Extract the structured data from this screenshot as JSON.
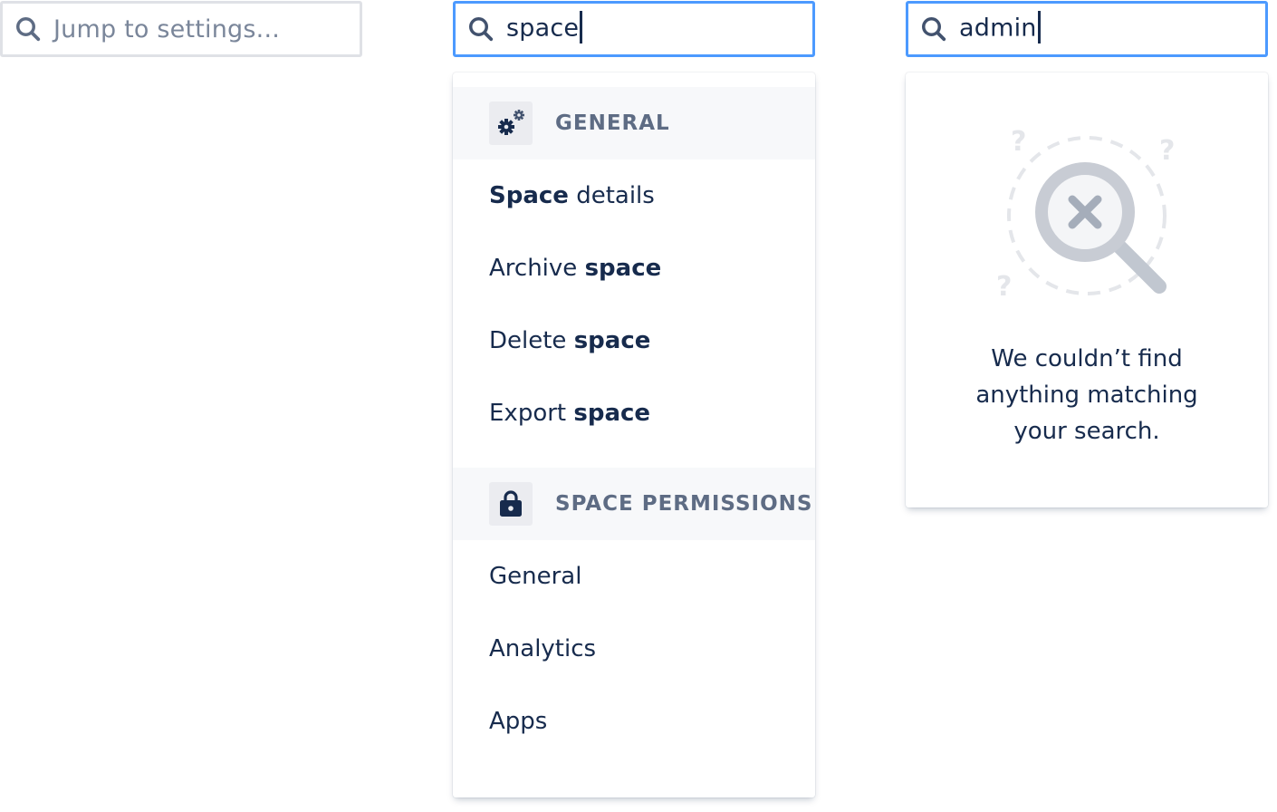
{
  "searches": [
    {
      "placeholder": "Jump to settings...",
      "value": ""
    },
    {
      "placeholder": "",
      "value": "space"
    },
    {
      "placeholder": "",
      "value": "admin"
    }
  ],
  "results": {
    "groups": [
      {
        "title": "GENERAL",
        "icon": "gears-icon",
        "items": [
          {
            "pre": "",
            "bold": "Space",
            "post": " details"
          },
          {
            "pre": "Archive ",
            "bold": "space",
            "post": ""
          },
          {
            "pre": "Delete ",
            "bold": "space",
            "post": ""
          },
          {
            "pre": "Export ",
            "bold": "space",
            "post": ""
          }
        ]
      },
      {
        "title": "SPACE PERMISSIONS",
        "icon": "lock-icon",
        "items": [
          {
            "pre": "General",
            "bold": "",
            "post": ""
          },
          {
            "pre": "Analytics",
            "bold": "",
            "post": ""
          },
          {
            "pre": "Apps",
            "bold": "",
            "post": ""
          }
        ]
      }
    ]
  },
  "empty_state": {
    "illustration": "no-results-magnifier-icon",
    "line1": "We couldn’t find",
    "line2": "anything matching",
    "line3": "your search."
  },
  "colors": {
    "text": "#172B4D",
    "subtle": "#5E6C84",
    "placeholder": "#7A869A",
    "focus_border": "#4C9AFF",
    "idle_border": "#DFE1E6",
    "group_bg": "#F7F8FA"
  }
}
